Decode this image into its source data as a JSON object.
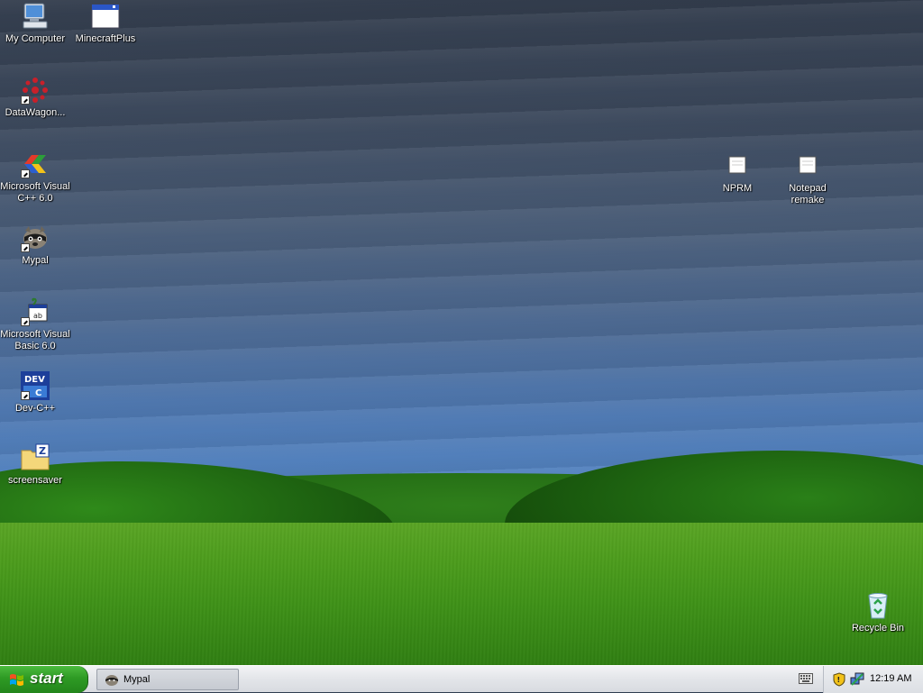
{
  "desktop": {
    "icons_left": [
      {
        "label": "My Computer",
        "icon": "computer-icon"
      },
      {
        "label": "DataWagon...",
        "icon": "datawagon-icon"
      },
      {
        "label": "Microsoft Visual C++ 6.0",
        "icon": "visual-cpp-icon"
      },
      {
        "label": "Mypal",
        "icon": "mypal-raccoon-icon"
      },
      {
        "label": "Microsoft Visual Basic 6.0",
        "icon": "visual-basic-icon"
      },
      {
        "label": "Dev-C++",
        "icon": "dev-cpp-icon"
      },
      {
        "label": "screensaver",
        "icon": "zip-folder-icon"
      }
    ],
    "icons_top": [
      {
        "label": "MinecraftPlus",
        "icon": "application-window-icon"
      }
    ],
    "icons_right": [
      {
        "label": "NPRM",
        "icon": "folder-icon"
      },
      {
        "label": "Notepad remake",
        "icon": "folder-icon"
      }
    ],
    "recycle_bin": {
      "label": "Recycle Bin",
      "icon": "recycle-bin-icon"
    }
  },
  "taskbar": {
    "start_label": "start",
    "tasks": [
      {
        "label": "Mypal",
        "icon": "mypal-raccoon-icon"
      }
    ],
    "tray": {
      "clock": "12:19 AM",
      "icons": [
        "keyboard-icon",
        "security-shield-icon",
        "network-icon"
      ]
    }
  },
  "colors": {
    "start_green": "#2e9a24",
    "taskbar_silver": "#e4e6ea",
    "sky_top": "#333d4d",
    "grass": "#3f9317"
  }
}
